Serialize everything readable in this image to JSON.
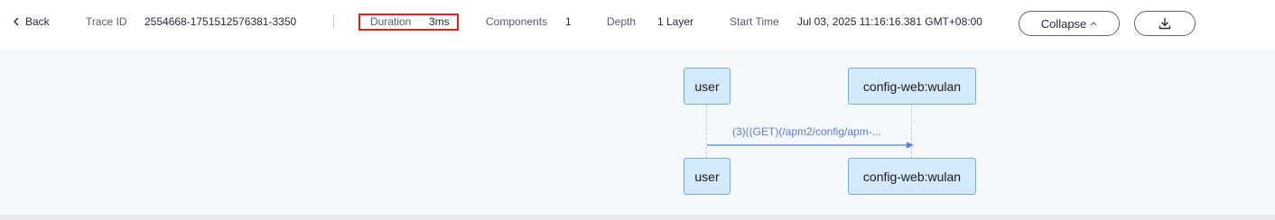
{
  "header": {
    "back_label": "Back",
    "trace_id_label": "Trace ID",
    "trace_id_value": "2554668-1751512576381-3350",
    "duration_label": "Duration",
    "duration_value": "3ms",
    "components_label": "Components",
    "components_value": "1",
    "depth_label": "Depth",
    "depth_value": "1 Layer",
    "start_time_label": "Start Time",
    "start_time_value": "Jul 03, 2025 11:16:16.381 GMT+08:00",
    "collapse_label": "Collapse",
    "icons": {
      "back": "chevron-left-icon",
      "collapse": "chevron-up-icon",
      "download": "download-icon"
    }
  },
  "diagram": {
    "participants_top": [
      "user",
      "config-web:wulan"
    ],
    "participants_bottom": [
      "user",
      "config-web:wulan"
    ],
    "messages": [
      {
        "label": "(3)((GET)(/apm2/config/apm-...",
        "from": "user",
        "to": "config-web:wulan"
      }
    ],
    "colors": {
      "node_fill": "#d4e9fb",
      "node_border": "#6cb0ea",
      "message": "#5b7fc9",
      "highlight": "#e02020"
    }
  }
}
